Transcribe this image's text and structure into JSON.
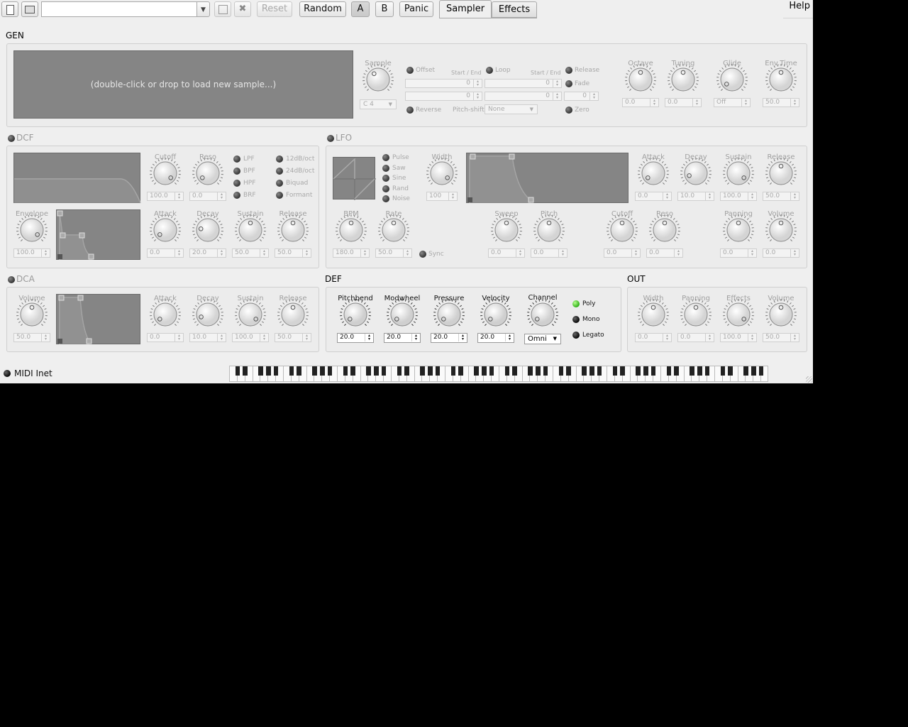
{
  "toolbar": {
    "preset_value": "",
    "reset_label": "Reset",
    "random_label": "Random",
    "a_label": "A",
    "b_label": "B",
    "panic_label": "Panic",
    "tab_sampler": "Sampler",
    "tab_effects": "Effects",
    "help_label": "Help"
  },
  "gen": {
    "title": "GEN",
    "sample_hint": "(double-click or drop to load new sample...)",
    "sample_label": "Sample",
    "note_value": "C 4",
    "offset_label": "Offset",
    "loop_label": "Loop",
    "release_label": "Release",
    "fade_label": "Fade",
    "reverse_label": "Reverse",
    "zero_label": "Zero",
    "start_end_1": "Start / End",
    "start_end_2": "Start / End",
    "offset_start": "0",
    "offset_end": "0",
    "loop_start": "0",
    "loop_end": "0",
    "fade_value": "0",
    "pitchshift_label": "Pitch-shift:",
    "pitchshift_value": "None",
    "knobs": [
      {
        "label": "Octave",
        "value": "0.0"
      },
      {
        "label": "Tuning",
        "value": "0.0"
      },
      {
        "label": "Glide",
        "value": "Off"
      },
      {
        "label": "Env.Time",
        "value": "50.0"
      }
    ]
  },
  "dcf": {
    "title": "DCF",
    "filters": [
      "LPF",
      "BPF",
      "HPF",
      "BRF"
    ],
    "slopes": [
      "12dB/oct",
      "24dB/oct",
      "Biquad",
      "Formant"
    ],
    "knobs_top": [
      {
        "label": "Cutoff",
        "value": "100.0"
      },
      {
        "label": "Reso",
        "value": "0.0"
      }
    ],
    "envelope": {
      "label": "Envelope",
      "value": "100.0"
    },
    "knobs_bottom": [
      {
        "label": "Attack",
        "value": "0.0"
      },
      {
        "label": "Decay",
        "value": "20.0"
      },
      {
        "label": "Sustain",
        "value": "50.0"
      },
      {
        "label": "Release",
        "value": "50.0"
      }
    ]
  },
  "lfo": {
    "title": "LFO",
    "shapes": [
      "Pulse",
      "Saw",
      "Sine",
      "Rand",
      "Noise"
    ],
    "width": {
      "label": "Width",
      "value": "100"
    },
    "knobs_top": [
      {
        "label": "Attack",
        "value": "0.0"
      },
      {
        "label": "Decay",
        "value": "10.0"
      },
      {
        "label": "Sustain",
        "value": "100.0"
      },
      {
        "label": "Release",
        "value": "50.0"
      }
    ],
    "bpm": {
      "label": "BPM",
      "value": "180.0"
    },
    "rate": {
      "label": "Rate",
      "value": "50.0"
    },
    "sync_label": "Sync",
    "knobs_bottom": [
      {
        "label": "Sweep",
        "value": "0.0"
      },
      {
        "label": "Pitch",
        "value": "0.0"
      },
      {
        "label": "Cutoff",
        "value": "0.0"
      },
      {
        "label": "Reso",
        "value": "0.0"
      },
      {
        "label": "Panning",
        "value": "0.0"
      },
      {
        "label": "Volume",
        "value": "0.0"
      }
    ]
  },
  "dca": {
    "title": "DCA",
    "volume": {
      "label": "Volume",
      "value": "50.0"
    },
    "knobs": [
      {
        "label": "Attack",
        "value": "0.0"
      },
      {
        "label": "Decay",
        "value": "10.0"
      },
      {
        "label": "Sustain",
        "value": "100.0"
      },
      {
        "label": "Release",
        "value": "50.0"
      }
    ]
  },
  "def": {
    "title": "DEF",
    "knobs": [
      {
        "label": "Pitchbend",
        "value": "20.0"
      },
      {
        "label": "Modwheel",
        "value": "20.0"
      },
      {
        "label": "Pressure",
        "value": "20.0"
      },
      {
        "label": "Velocity",
        "value": "20.0"
      }
    ],
    "channel_label": "Channel",
    "channel_value": "Omni",
    "modes": [
      "Poly",
      "Mono",
      "Legato"
    ]
  },
  "out": {
    "title": "OUT",
    "knobs": [
      {
        "label": "Width",
        "value": "0.0"
      },
      {
        "label": "Panning",
        "value": "0.0"
      },
      {
        "label": "Effects",
        "value": "100.0"
      },
      {
        "label": "Volume",
        "value": "50.0"
      }
    ]
  },
  "status": {
    "midi_label": "MIDI Inet"
  },
  "colors": {
    "panel_bg": "#ececec",
    "screen_bg": "#858585",
    "led_on": "#2fae18"
  }
}
